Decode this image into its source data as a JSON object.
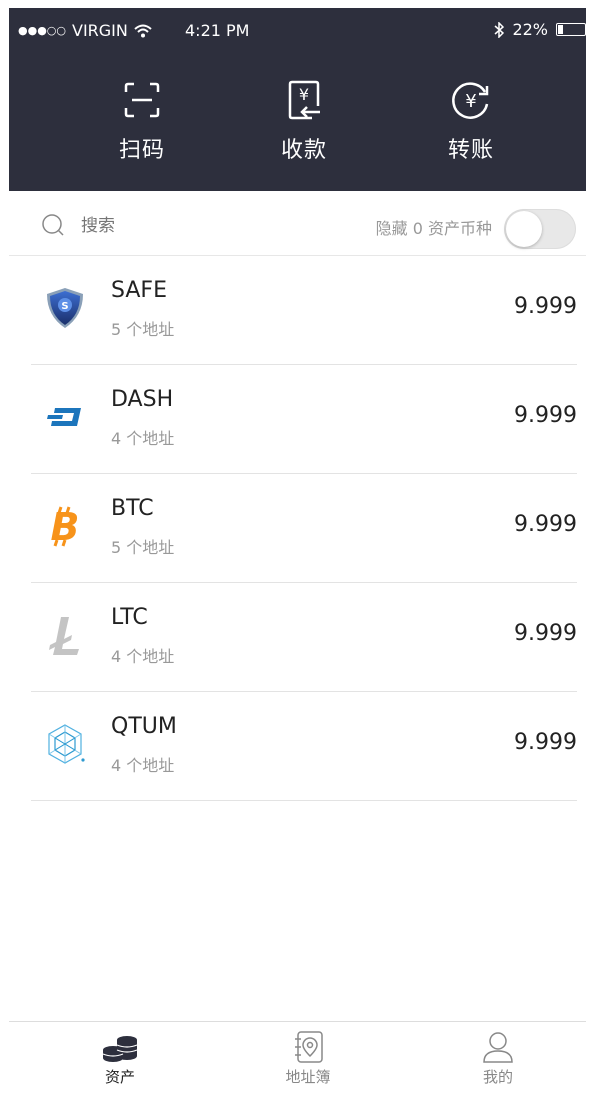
{
  "status_bar": {
    "signal": "●●●○○",
    "carrier": "VIRGIN",
    "time": "4:21 PM",
    "battery_text": "22%",
    "battery_level": 0.22
  },
  "header": {
    "actions": [
      {
        "label": "扫码",
        "icon": "scan-icon"
      },
      {
        "label": "收款",
        "icon": "receive-icon"
      },
      {
        "label": "转账",
        "icon": "transfer-icon"
      }
    ]
  },
  "search": {
    "placeholder": "搜索",
    "hide_zero_label": "隐藏 0 资产币种",
    "hide_zero_enabled": false
  },
  "assets": [
    {
      "name": "SAFE",
      "addresses": "5 个地址",
      "amount": "9.999",
      "icon": "safe-coin-icon"
    },
    {
      "name": "DASH",
      "addresses": "4 个地址",
      "amount": "9.999",
      "icon": "dash-coin-icon"
    },
    {
      "name": "BTC",
      "addresses": "5 个地址",
      "amount": "9.999",
      "icon": "btc-coin-icon"
    },
    {
      "name": "LTC",
      "addresses": "4 个地址",
      "amount": "9.999",
      "icon": "ltc-coin-icon"
    },
    {
      "name": "QTUM",
      "addresses": "4 个地址",
      "amount": "9.999",
      "icon": "qtum-coin-icon"
    }
  ],
  "tabbar": {
    "tabs": [
      {
        "label": "资产",
        "icon": "coins-icon",
        "active": true
      },
      {
        "label": "地址簿",
        "icon": "address-book-icon",
        "active": false
      },
      {
        "label": "我的",
        "icon": "profile-icon",
        "active": false
      }
    ]
  },
  "colors": {
    "header_bg": "#2d2f3d",
    "btc": "#f7931a",
    "dash": "#1c75bc",
    "safe": "#1e3f8a",
    "ltc": "#bebebe",
    "qtum": "#2e9ad0"
  }
}
